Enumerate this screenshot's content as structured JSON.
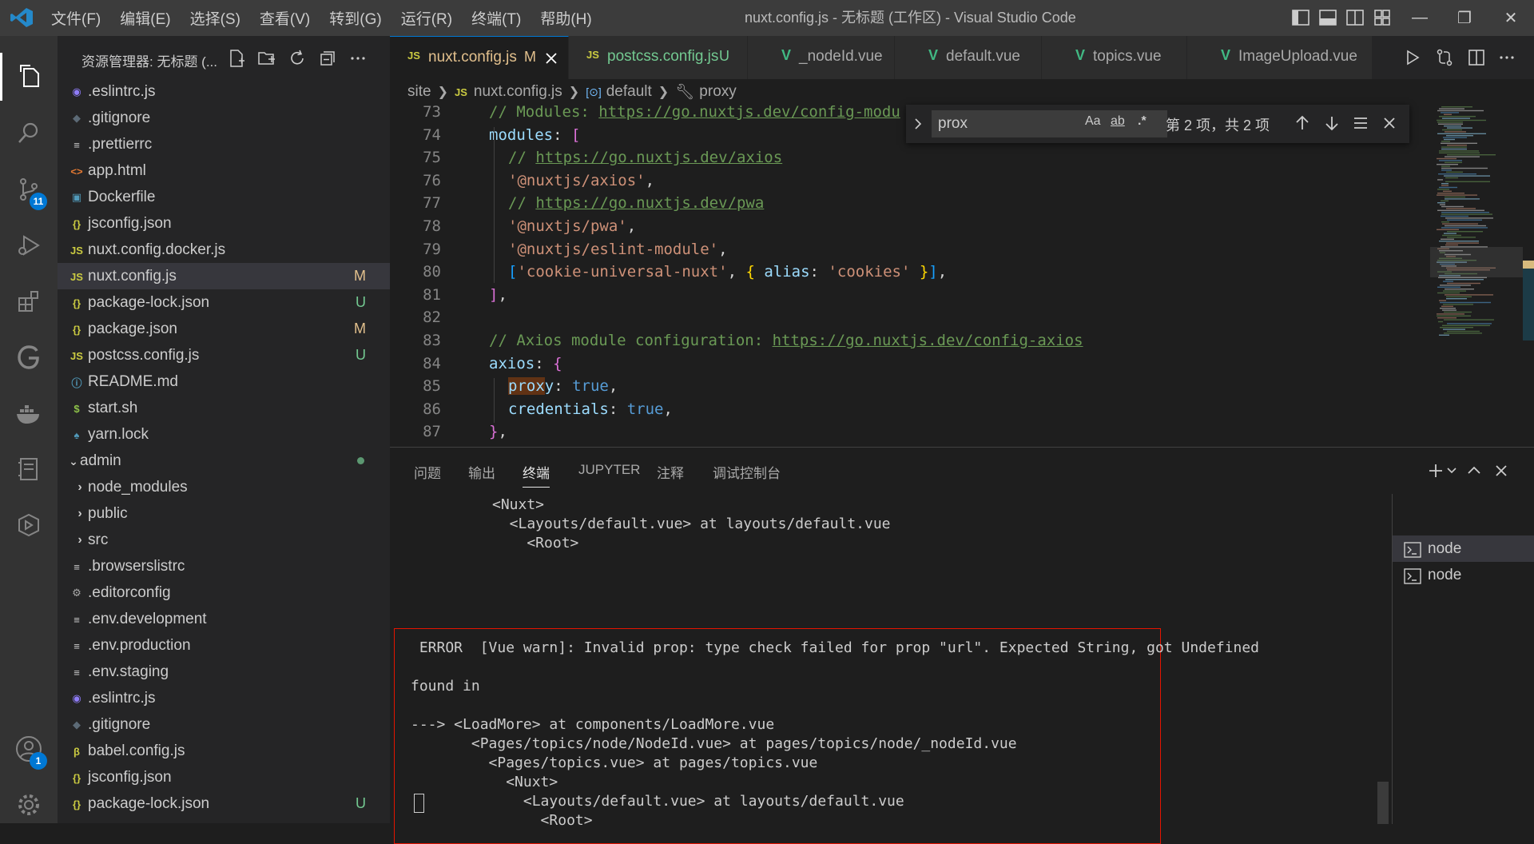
{
  "window": {
    "title": "nuxt.config.js - 无标题 (工作区) - Visual Studio Code",
    "menu": [
      "文件(F)",
      "编辑(E)",
      "选择(S)",
      "查看(V)",
      "转到(G)",
      "运行(R)",
      "终端(T)",
      "帮助(H)"
    ],
    "accent_color": "#0078d4"
  },
  "activity_bar": {
    "items": [
      "explorer-icon",
      "search-icon",
      "source-control-icon",
      "run-debug-icon",
      "extensions-icon",
      "gitlens-icon",
      "docker-icon",
      "notebook-icon",
      "remote-icon"
    ],
    "source_control_badge": "11",
    "accounts_badge": "1"
  },
  "sidebar": {
    "title": "资源管理器: 无标题 (...",
    "files": [
      {
        "name": ".eslintrc.js",
        "icon": "eslint",
        "status": ""
      },
      {
        "name": ".gitignore",
        "icon": "git",
        "status": ""
      },
      {
        "name": ".prettierrc",
        "icon": "lines",
        "status": ""
      },
      {
        "name": "app.html",
        "icon": "html",
        "status": ""
      },
      {
        "name": "Dockerfile",
        "icon": "docker",
        "status": ""
      },
      {
        "name": "jsconfig.json",
        "icon": "json",
        "status": ""
      },
      {
        "name": "nuxt.config.docker.js",
        "icon": "js",
        "status": ""
      },
      {
        "name": "nuxt.config.js",
        "icon": "js",
        "status": "M"
      },
      {
        "name": "package-lock.json",
        "icon": "json",
        "status": "U"
      },
      {
        "name": "package.json",
        "icon": "json",
        "status": "M"
      },
      {
        "name": "postcss.config.js",
        "icon": "js",
        "status": "U"
      },
      {
        "name": "README.md",
        "icon": "info",
        "status": ""
      },
      {
        "name": "start.sh",
        "icon": "shell",
        "status": ""
      },
      {
        "name": "yarn.lock",
        "icon": "yarn",
        "status": ""
      },
      {
        "name": "admin",
        "icon": "folder-open",
        "status": "dot"
      },
      {
        "name": "node_modules",
        "icon": "folder",
        "status": ""
      },
      {
        "name": "public",
        "icon": "folder",
        "status": ""
      },
      {
        "name": "src",
        "icon": "folder",
        "status": ""
      },
      {
        "name": ".browserslistrc",
        "icon": "lines",
        "status": ""
      },
      {
        "name": ".editorconfig",
        "icon": "gear",
        "status": ""
      },
      {
        "name": ".env.development",
        "icon": "lines",
        "status": ""
      },
      {
        "name": ".env.production",
        "icon": "lines",
        "status": ""
      },
      {
        "name": ".env.staging",
        "icon": "lines",
        "status": ""
      },
      {
        "name": ".eslintrc.js",
        "icon": "eslint",
        "status": ""
      },
      {
        "name": ".gitignore",
        "icon": "git",
        "status": ""
      },
      {
        "name": "babel.config.js",
        "icon": "babel",
        "status": ""
      },
      {
        "name": "jsconfig.json",
        "icon": "json",
        "status": ""
      },
      {
        "name": "package-lock.json",
        "icon": "json",
        "status": "U"
      }
    ]
  },
  "tabs": [
    {
      "label": "nuxt.config.js",
      "icon": "JS",
      "status": "M",
      "active": true
    },
    {
      "label": "postcss.config.js",
      "icon": "JS",
      "status": "U"
    },
    {
      "label": "_nodeId.vue",
      "icon": "V",
      "status": ""
    },
    {
      "label": "default.vue",
      "icon": "V",
      "status": ""
    },
    {
      "label": "topics.vue",
      "icon": "V",
      "status": ""
    },
    {
      "label": "ImageUpload.vue",
      "icon": "V",
      "status": ""
    }
  ],
  "breadcrumb": {
    "site": "site",
    "js_icon": "JS",
    "file": "nuxt.config.js",
    "symbol1": "default",
    "symbol2": "proxy"
  },
  "editor": {
    "line_numbers": [
      "73",
      "74",
      "75",
      "76",
      "77",
      "78",
      "79",
      "80",
      "81",
      "82",
      "83",
      "84",
      "85",
      "86",
      "87"
    ],
    "l73_comment": "// Modules: ",
    "l73_url": "https://go.nuxtjs.dev/config-modu",
    "l74_key": "modules",
    "l74_colon": ": ",
    "l74_bracket": "[",
    "l75_comment": "// ",
    "l75_url": "https://go.nuxtjs.dev/axios",
    "l76_str": "'@nuxtjs/axios'",
    "comma": ",",
    "l77_comment": "// ",
    "l77_url": "https://go.nuxtjs.dev/pwa",
    "l78_str": "'@nuxtjs/pwa'",
    "l79_str": "'@nuxtjs/eslint-module'",
    "l80_open": "[",
    "l80_str": "'cookie-universal-nuxt'",
    "l80_sep": ", ",
    "l80_brace_open": "{",
    "l80_key": " alias",
    "l80_colon": ": ",
    "l80_val": "'cookies'",
    "l80_brace_close": " }",
    "l80_close": "]",
    "l81_close": "]",
    "l83_comment": "// Axios module configuration: ",
    "l83_url": "https://go.nuxtjs.dev/config-axios",
    "l84_key": "axios",
    "l84_colon": ": ",
    "l84_brace": "{",
    "l85_key_hl": "prox",
    "l85_key_rest": "y",
    "l85_colon": ": ",
    "l85_val": "true",
    "l86_key": "credentials",
    "l86_colon": ": ",
    "l86_val": "true",
    "l87_close": "}"
  },
  "find": {
    "query": "prox",
    "opt_case": "Aa",
    "opt_word": "ab",
    "opt_regex": ".*",
    "count": "第 2 项，共 2 项"
  },
  "panel": {
    "tabs": [
      "问题",
      "输出",
      "终端",
      "JUPYTER",
      "注释",
      "调试控制台"
    ],
    "active_tab": "终端",
    "terminal_lines_top": [
      "<Nuxt>",
      "  <Layouts/default.vue> at layouts/default.vue",
      "    <Root>"
    ],
    "error_lines": [
      " ERROR  [Vue warn]: Invalid prop: type check failed for prop \"url\". Expected String, got Undefined",
      "",
      "found in",
      "",
      "---> <LoadMore> at components/LoadMore.vue",
      "       <Pages/topics/node/NodeId.vue> at pages/topics/node/_nodeId.vue",
      "         <Pages/topics.vue> at pages/topics.vue",
      "           <Nuxt>",
      "             <Layouts/default.vue> at layouts/default.vue",
      "               <Root>"
    ],
    "terminals": [
      "node",
      "node"
    ]
  }
}
